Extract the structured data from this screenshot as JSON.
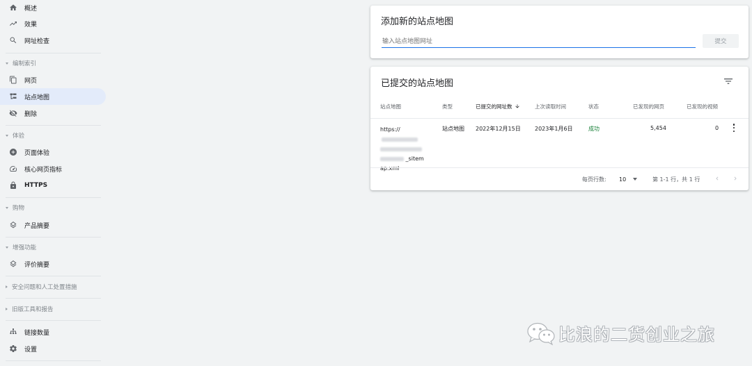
{
  "sidebar": {
    "items": [
      {
        "label": "概述",
        "icon": "home-icon"
      },
      {
        "label": "效果",
        "icon": "trending-up-icon"
      },
      {
        "label": "网址检查",
        "icon": "search-icon"
      },
      {
        "label": "网页",
        "icon": "pages-icon"
      },
      {
        "label": "站点地图",
        "icon": "sitemap-icon",
        "active": true
      },
      {
        "label": "删除",
        "icon": "visibility-off-icon"
      },
      {
        "label": "页面体验",
        "icon": "add-circle-icon"
      },
      {
        "label": "核心网页指标",
        "icon": "speed-icon"
      },
      {
        "label": "HTTPS",
        "icon": "lock-icon"
      },
      {
        "label": "产品摘要",
        "icon": "layers-icon"
      },
      {
        "label": "评价摘要",
        "icon": "layers-icon"
      },
      {
        "label": "链接数量",
        "icon": "links-icon"
      },
      {
        "label": "设置",
        "icon": "gear-icon"
      }
    ],
    "sections": [
      {
        "label": "编制索引",
        "expanded": true
      },
      {
        "label": "体验",
        "expanded": true
      },
      {
        "label": "购物",
        "expanded": true
      },
      {
        "label": "增强功能",
        "expanded": true
      },
      {
        "label": "安全问题和人工处置措施",
        "expanded": false
      },
      {
        "label": "旧版工具和报告",
        "expanded": false
      }
    ]
  },
  "add_sitemap": {
    "title": "添加新的站点地图",
    "placeholder": "输入站点地图网址",
    "submit_label": "提交"
  },
  "submitted": {
    "title": "已提交的站点地图",
    "columns": [
      "站点地图",
      "类型",
      "已提交的网址数",
      "上次读取时间",
      "状态",
      "已发现的网页",
      "已发现的视频"
    ],
    "sorted_column": "已提交的网址数",
    "rows": [
      {
        "url_start": "https://",
        "url_end_1": "_sitem",
        "url_end_2": "ap.xml",
        "type": "站点地图",
        "submitted_date": "2022年12月15日",
        "last_read": "2023年1月6日",
        "status": "成功",
        "pages": "5,454",
        "videos": "0"
      }
    ],
    "pager": {
      "rows_per_page_label": "每页行数:",
      "rows_per_page": "10",
      "range_text": "第 1-1 行，共 1 行"
    }
  },
  "watermark": {
    "text": "比浪的二货创业之旅",
    "icon": "wechat-icon"
  },
  "colors": {
    "accent": "#1a73e8",
    "active_bg": "#e3ebfa",
    "success": "#188038",
    "page_bg": "#f1f3f4"
  }
}
